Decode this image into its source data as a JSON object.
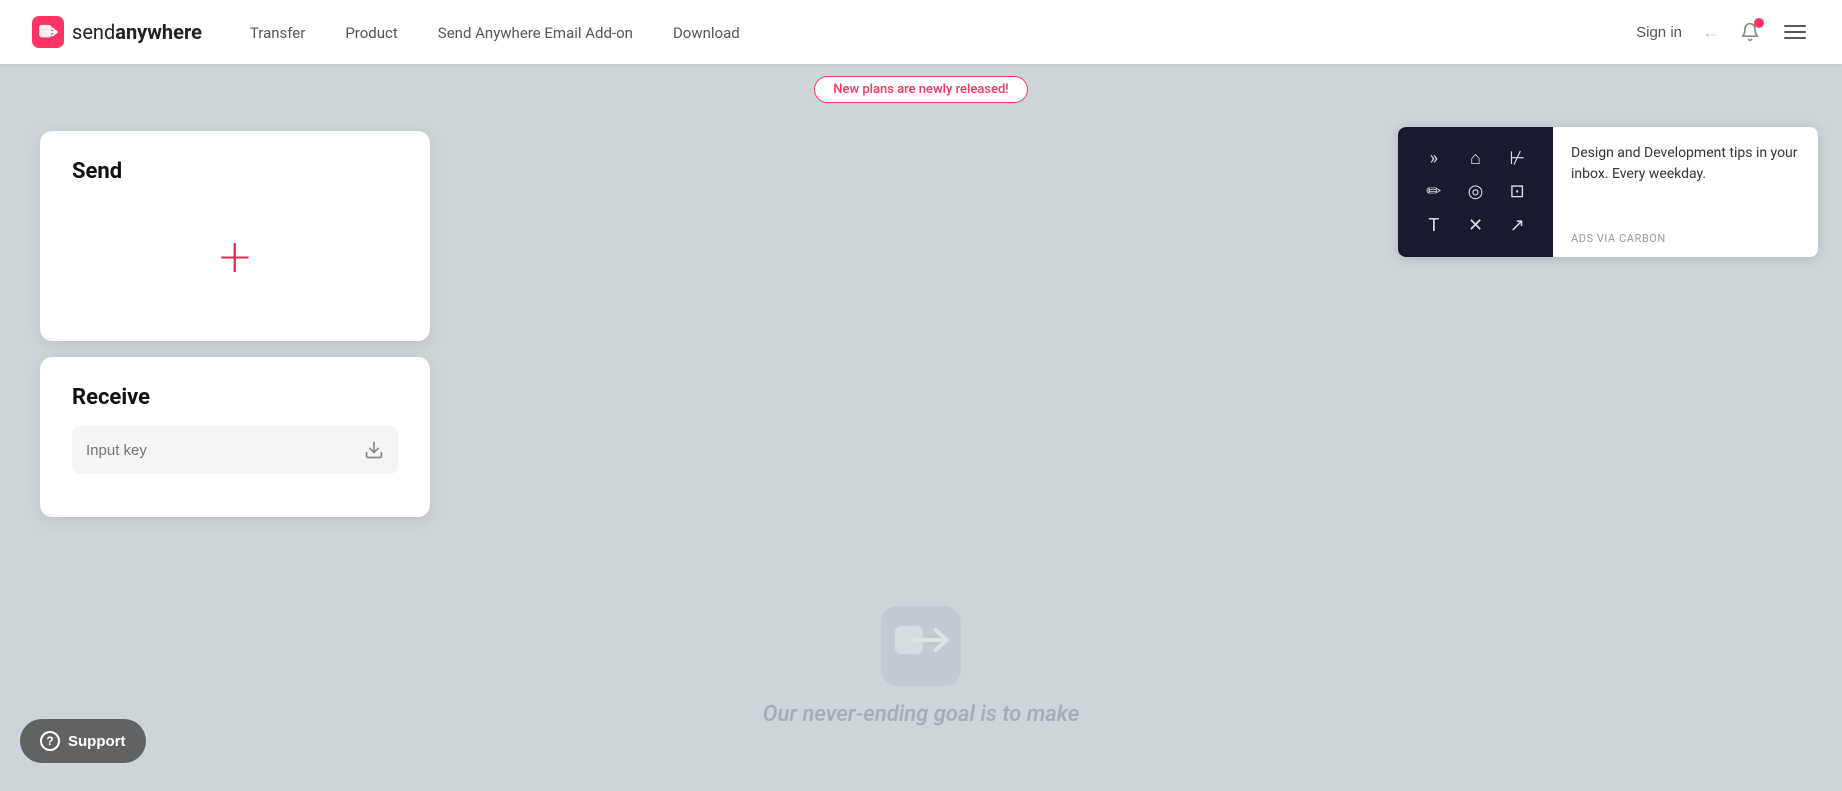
{
  "logo": {
    "send": "send",
    "anywhere": "anywhere",
    "alt": "Send Anywhere"
  },
  "nav": {
    "links": [
      {
        "id": "transfer",
        "label": "Transfer"
      },
      {
        "id": "product",
        "label": "Product"
      },
      {
        "id": "email-addon",
        "label": "Send Anywhere Email Add-on"
      },
      {
        "id": "download",
        "label": "Download"
      }
    ],
    "sign_in": "Sign in",
    "sign_in_arrow": "←"
  },
  "banner": {
    "text": "New plans are newly released!"
  },
  "send_card": {
    "title": "Send",
    "add_label": "+"
  },
  "receive_card": {
    "title": "Receive",
    "input_placeholder": "Input key"
  },
  "support_btn": {
    "label": "Support",
    "icon": "?"
  },
  "watermark": {
    "tagline": "Our never-ending goal is to make"
  },
  "ad": {
    "text": "Design and Development tips in your inbox. Every weekday.",
    "via": "ADS VIA CARBON"
  },
  "ad_icons": [
    "»",
    "⌂",
    "⊬",
    "✏",
    "◯",
    "⊡",
    "T",
    "✕",
    "↗"
  ]
}
